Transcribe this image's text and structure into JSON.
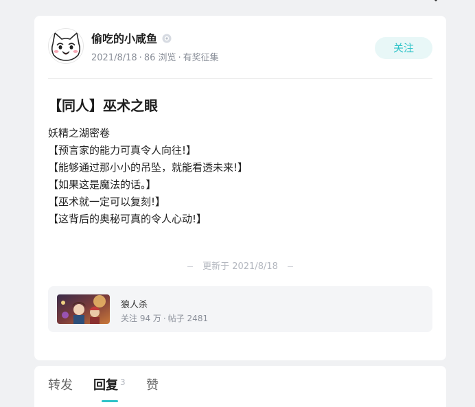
{
  "author": {
    "name": "偷吃的小咸鱼",
    "date": "2021/8/18",
    "views": "86 浏览",
    "event": "有奖征集"
  },
  "follow_button": {
    "label": "关注"
  },
  "post": {
    "title": "【同人】巫术之眼",
    "lines": [
      "妖精之湖密卷",
      "【预言家的能力可真令人向往!】",
      "【能够通过那小小的吊坠，就能看透未来!】",
      "【如果这是魔法的话。】",
      "【巫术就一定可以复刻!】",
      "【这背后的奥秘可真的令人心动!】"
    ],
    "updated": "更新于 2021/8/18"
  },
  "community": {
    "name": "狼人杀",
    "followers": "关注 94 万",
    "posts": "帖子 2481"
  },
  "tabs": {
    "forward": "转发",
    "reply": "回复",
    "reply_count": "3",
    "like": "赞"
  },
  "colors": {
    "accent": "#2fc3c8",
    "follow_bg": "#e8f7f7",
    "page_bg": "#f0f1f3"
  },
  "icons": {
    "avatar": "cat-face-avatar",
    "verify": "verified-badge-icon",
    "top": "chevron-down-icon"
  }
}
